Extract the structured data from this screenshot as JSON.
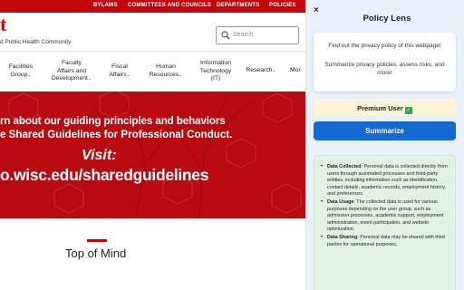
{
  "site": {
    "topbar_links": [
      "BYLAWS",
      "COMMITTEES AND COUNCILS",
      "DEPARTMENTS",
      "POLICIES"
    ],
    "logo_fragment": "t",
    "subtitle": "d Public Health Community",
    "search_placeholder": "Search",
    "nav": [
      {
        "line1": "Facilities",
        "line2": "Group",
        "line3": ""
      },
      {
        "line1": "Faculty",
        "line2": "Affairs and",
        "line3": "Development"
      },
      {
        "line1": "Fiscal",
        "line2": "Affairs",
        "line3": ""
      },
      {
        "line1": "Human",
        "line2": "Resources",
        "line3": ""
      },
      {
        "line1": "Information",
        "line2": "Technology",
        "line3": "(IT)"
      },
      {
        "line1": "Research",
        "line2": "",
        "line3": ""
      },
      {
        "line1": "Mor",
        "line2": "",
        "line3": ""
      }
    ],
    "hero": {
      "line1": "rn about our guiding principles and behaviors",
      "line2": "e Shared Guidelines for Professional Conduct.",
      "visit": "Visit:",
      "url": "o.wisc.edu/sharedguidelines"
    },
    "section_title": "Top of Mind",
    "colors": {
      "brand_red": "#c5050c",
      "hero_red": "#b90a12"
    }
  },
  "panel": {
    "close_label": "×",
    "title": "Policy Lens",
    "card_line1": "Find out the privacy policy of this webpage!",
    "card_line2": "Summarize privacy policies, assess risks, and more!",
    "premium_label": "Premium User",
    "premium_icon": "✓",
    "summarize_label": "Summarize",
    "results": [
      {
        "label": "Data Collected",
        "text": ": Personal data is collected directly from users through automated processes and third-party entities, including information such as identification, contact details, academic records, employment history, and preferences."
      },
      {
        "label": "Data Usage",
        "text": ": The collected data is used for various purposes depending on the user group, such as admission processes, academic support, employment administration, event participation, and website optimization."
      },
      {
        "label": "Data Sharing",
        "text": ": Personal data may be shared with third parties for operational purposes,"
      }
    ],
    "colors": {
      "panel_bg": "#e8f1fb",
      "button_blue": "#1769d2",
      "premium_bg": "#fff3d9",
      "results_bg": "#e1f4e4"
    }
  }
}
